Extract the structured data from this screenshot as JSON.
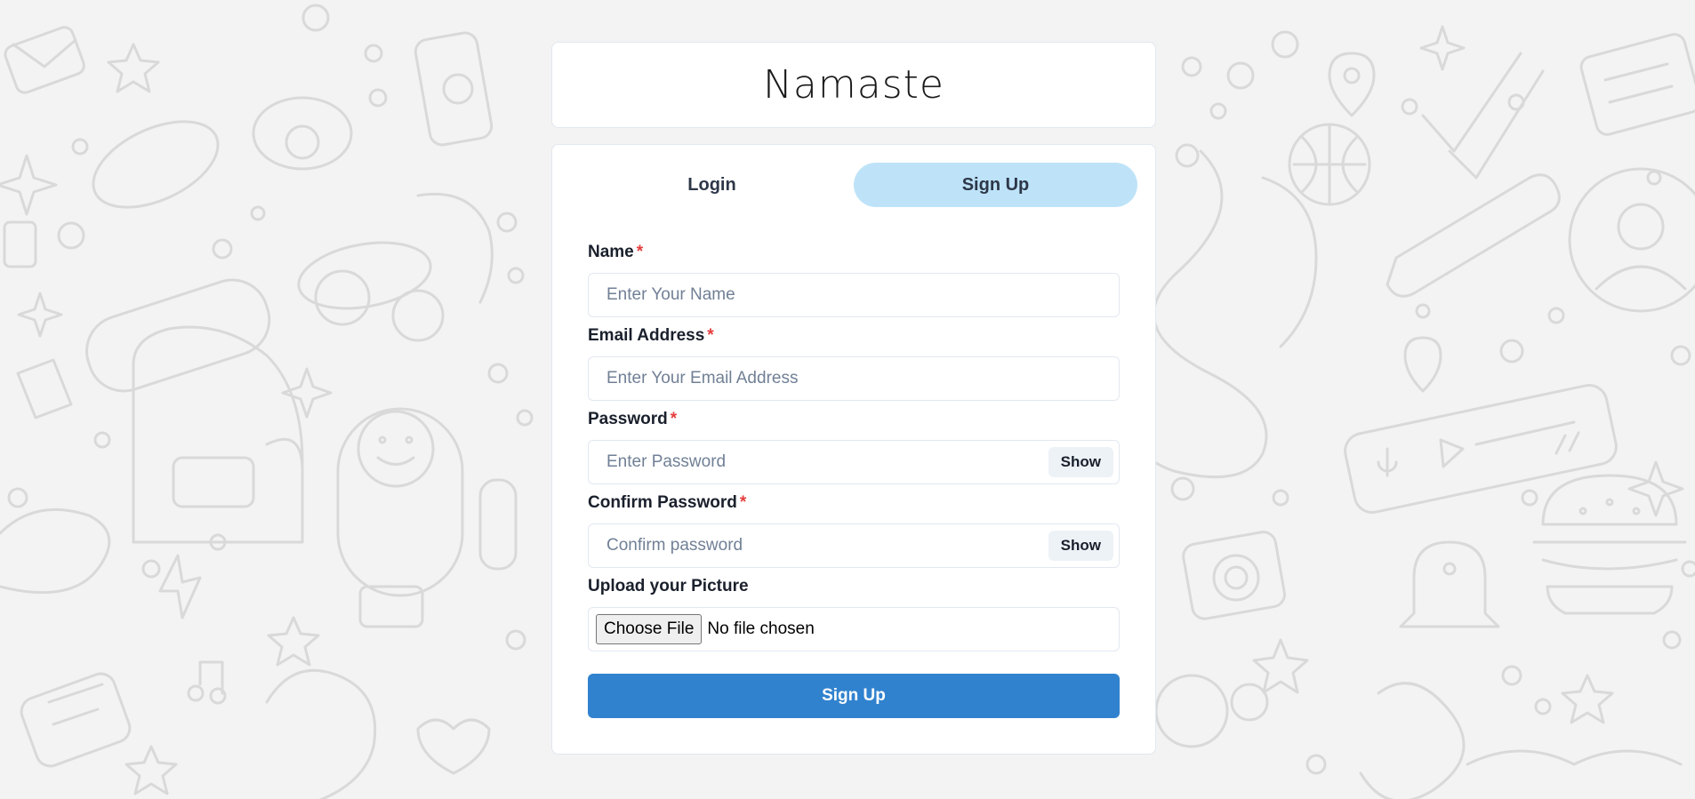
{
  "app": {
    "title": "Namaste"
  },
  "tabs": [
    {
      "label": "Login",
      "active": false
    },
    {
      "label": "Sign Up",
      "active": true
    }
  ],
  "form": {
    "name": {
      "label": "Name",
      "required_mark": "*",
      "placeholder": "Enter Your Name",
      "value": ""
    },
    "email": {
      "label": "Email Address",
      "required_mark": "*",
      "placeholder": "Enter Your Email Address",
      "value": ""
    },
    "password": {
      "label": "Password",
      "required_mark": "*",
      "placeholder": "Enter Password",
      "value": "",
      "toggle_label": "Show"
    },
    "confirm_password": {
      "label": "Confirm Password",
      "required_mark": "*",
      "placeholder": "Confirm password",
      "value": "",
      "toggle_label": "Show"
    },
    "picture": {
      "label": "Upload your Picture",
      "choose_label": "Choose File",
      "status": "No file chosen"
    },
    "submit_label": "Sign Up"
  },
  "colors": {
    "accent": "#3182ce",
    "active_tab": "#bee3f8",
    "required": "#e53e3e",
    "background": "#f3f3f3"
  },
  "icons": {
    "background": "doodle-pattern"
  }
}
